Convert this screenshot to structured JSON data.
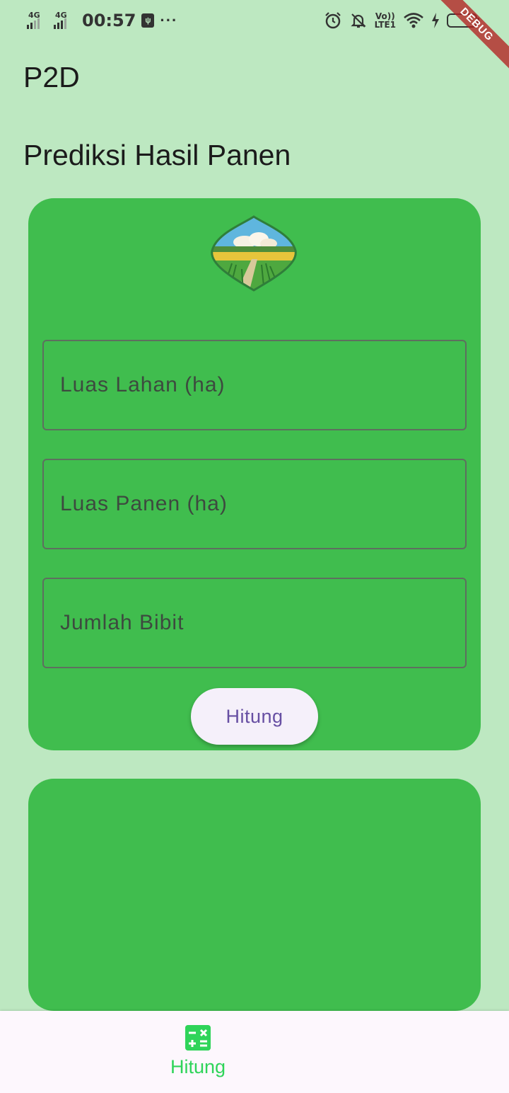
{
  "status_bar": {
    "network_1": "4G",
    "network_2": "4G",
    "time": "00:57",
    "more": "···",
    "volte_top": "Vo))",
    "volte_bottom": "LTE1",
    "debug_label": "DEBUG"
  },
  "app_bar": {
    "title": "P2D"
  },
  "page": {
    "heading": "Prediksi Hasil Panen"
  },
  "form": {
    "luas_lahan": {
      "placeholder": "Luas Lahan (ha)",
      "value": ""
    },
    "luas_panen": {
      "placeholder": "Luas Panen (ha)",
      "value": ""
    },
    "jumlah_bibit": {
      "placeholder": "Jumlah Bibit",
      "value": ""
    },
    "submit_label": "Hitung"
  },
  "bottom_nav": {
    "items": [
      {
        "label": "Hitung",
        "icon": "calculator-icon",
        "active": true
      }
    ]
  },
  "colors": {
    "background": "#bde8c1",
    "card": "#40bd4e",
    "accent": "#2fd45a",
    "button_text": "#674fa3"
  }
}
